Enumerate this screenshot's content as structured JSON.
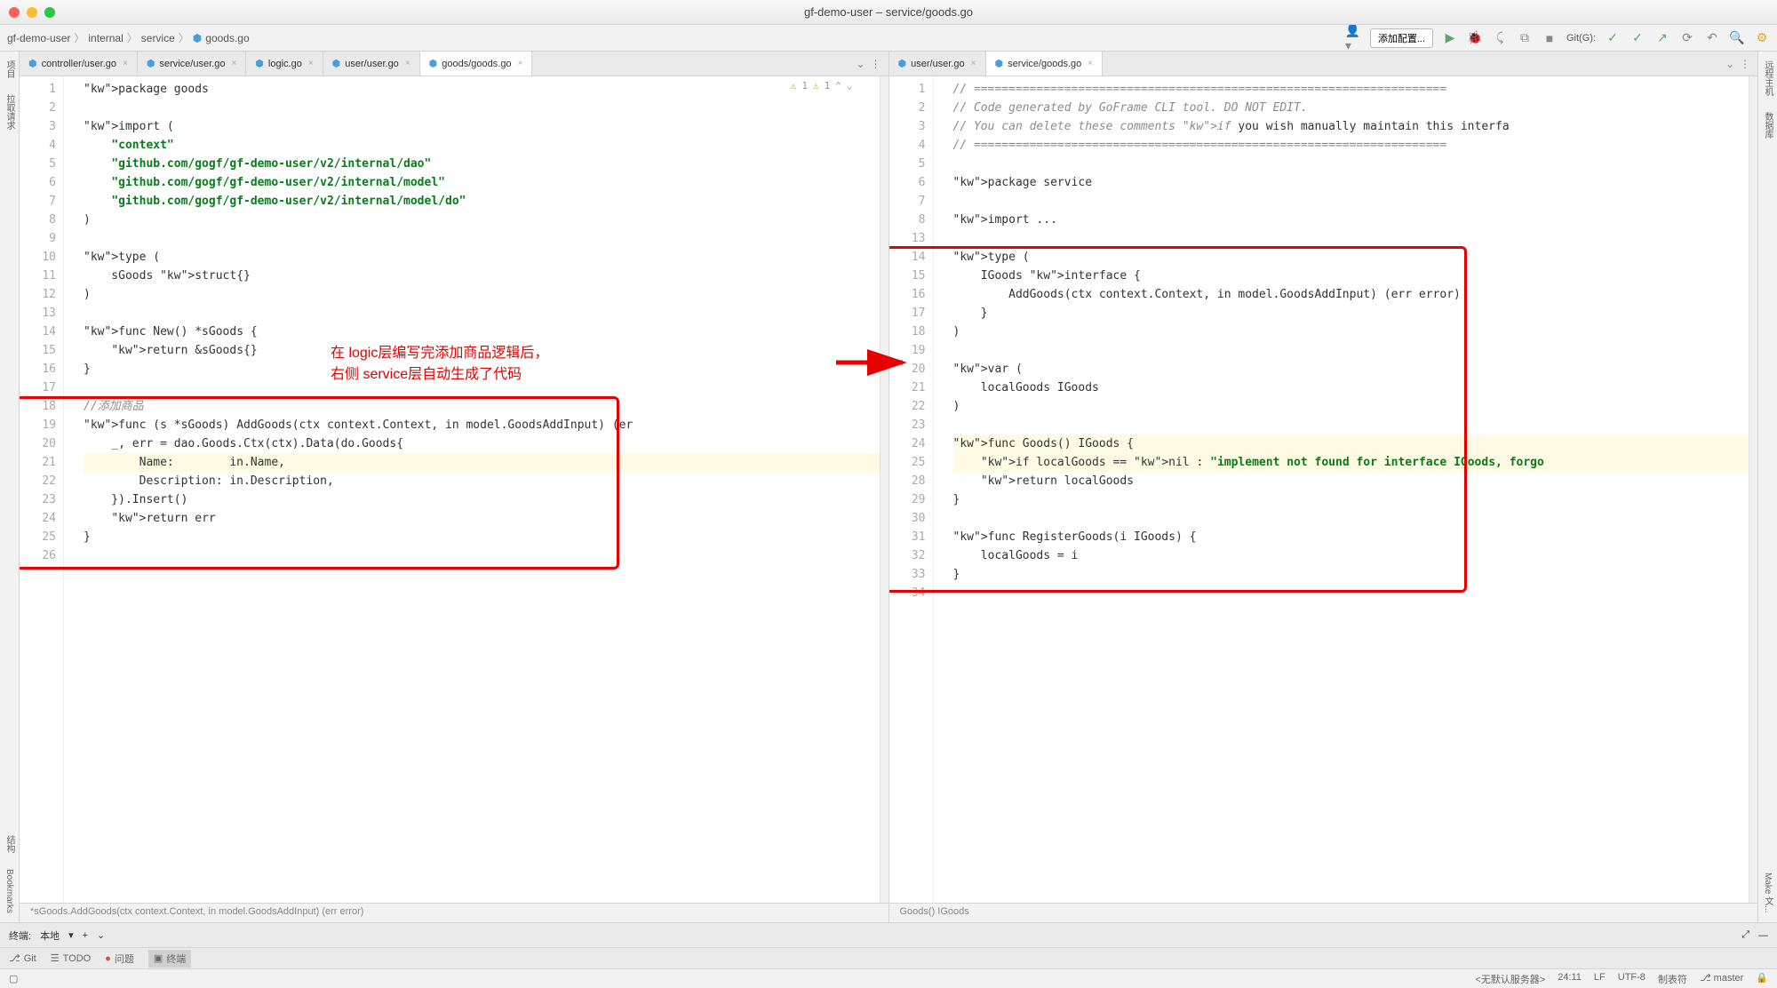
{
  "title": "gf-demo-user – service/goods.go",
  "breadcrumb": [
    "gf-demo-user",
    "internal",
    "service",
    "goods.go"
  ],
  "sidebar_left": [
    "项目",
    "拉取请求",
    "结构",
    "Bookmarks"
  ],
  "sidebar_right": [
    "远程主机",
    "数据库",
    "Make 文..."
  ],
  "toolbar": {
    "config": "添加配置...",
    "git_label": "Git(G):"
  },
  "tabs_left": [
    {
      "name": "controller/user.go",
      "active": false
    },
    {
      "name": "service/user.go",
      "active": false
    },
    {
      "name": "logic.go",
      "active": false
    },
    {
      "name": "user/user.go",
      "active": false
    },
    {
      "name": "goods/goods.go",
      "active": true
    }
  ],
  "tabs_right": [
    {
      "name": "user/user.go",
      "active": false
    },
    {
      "name": "service/goods.go",
      "active": true
    }
  ],
  "code_left": {
    "lines": [
      "package goods",
      "",
      "import (",
      "    \"context\"",
      "    \"github.com/gogf/gf-demo-user/v2/internal/dao\"",
      "    \"github.com/gogf/gf-demo-user/v2/internal/model\"",
      "    \"github.com/gogf/gf-demo-user/v2/internal/model/do\"",
      ")",
      "",
      "type (",
      "    sGoods struct{}",
      ")",
      "",
      "func New() *sGoods {",
      "    return &sGoods{}",
      "}",
      "",
      "//添加商品",
      "func (s *sGoods) AddGoods(ctx context.Context, in model.GoodsAddInput) (er",
      "    _, err = dao.Goods.Ctx(ctx).Data(do.Goods{",
      "        Name:        in.Name,",
      "        Description: in.Description,",
      "    }).Insert()",
      "    return err",
      "}",
      ""
    ],
    "start": 1,
    "crumb": "*sGoods.AddGoods(ctx context.Context, in model.GoodsAddInput) (err error)",
    "warnings": {
      "w1": "1",
      "w2": "1"
    }
  },
  "code_right": {
    "lines": [
      "// ====================================================================",
      "// Code generated by GoFrame CLI tool. DO NOT EDIT.",
      "// You can delete these comments if you wish manually maintain this interfa",
      "// ====================================================================",
      "",
      "package service",
      "",
      "import ...",
      "",
      "type (",
      "    IGoods interface {",
      "        AddGoods(ctx context.Context, in model.GoodsAddInput) (err error)",
      "    }",
      ")",
      "",
      "var (",
      "    localGoods IGoods",
      ")",
      "",
      "func Goods() IGoods {",
      "    if localGoods == nil : \"implement not found for interface IGoods, forgo",
      "    return localGoods",
      "}",
      "",
      "func RegisterGoods(i IGoods) {",
      "    localGoods = i",
      "}",
      ""
    ],
    "line_numbers": [
      1,
      2,
      3,
      4,
      5,
      6,
      7,
      8,
      13,
      14,
      15,
      16,
      17,
      18,
      19,
      20,
      21,
      22,
      23,
      24,
      25,
      28,
      29,
      30,
      31,
      32,
      33,
      34
    ],
    "crumb": "Goods() IGoods"
  },
  "annotation": {
    "line1": "在 logic层编写完添加商品逻辑后，",
    "line2": "右侧 service层自动生成了代码"
  },
  "terminal": {
    "label": "终端:",
    "tab": "本地"
  },
  "status": {
    "git": "Git",
    "todo": "TODO",
    "problems": "问题",
    "terminal": "终端"
  },
  "footer": {
    "server": "<无默认服务器>",
    "pos": "24:11",
    "lf": "LF",
    "enc": "UTF-8",
    "tabs": "制表符",
    "branch": "master"
  }
}
